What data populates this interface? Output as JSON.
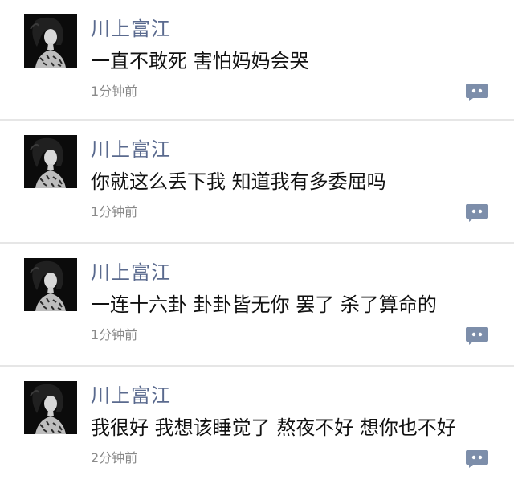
{
  "posts": [
    {
      "author": "川上富江",
      "content": "一直不敢死 害怕妈妈会哭",
      "time": "1分钟前",
      "avatar_icon": "portrait-avatar",
      "action_icon": "comment-icon"
    },
    {
      "author": "川上富江",
      "content": "你就这么丢下我 知道我有多委屈吗",
      "time": "1分钟前",
      "avatar_icon": "portrait-avatar",
      "action_icon": "comment-icon"
    },
    {
      "author": "川上富江",
      "content": "一连十六卦 卦卦皆无你 罢了 杀了算命的",
      "time": "1分钟前",
      "avatar_icon": "portrait-avatar",
      "action_icon": "comment-icon"
    },
    {
      "author": "川上富江",
      "content": "我很好 我想该睡觉了 熬夜不好 想你也不好",
      "time": "2分钟前",
      "avatar_icon": "portrait-avatar",
      "action_icon": "comment-icon"
    }
  ],
  "colors": {
    "author": "#5a6a8e",
    "content": "#111111",
    "time": "#8a8a8a",
    "action_button": "#7d8eaa",
    "divider": "#e6e6e6"
  }
}
